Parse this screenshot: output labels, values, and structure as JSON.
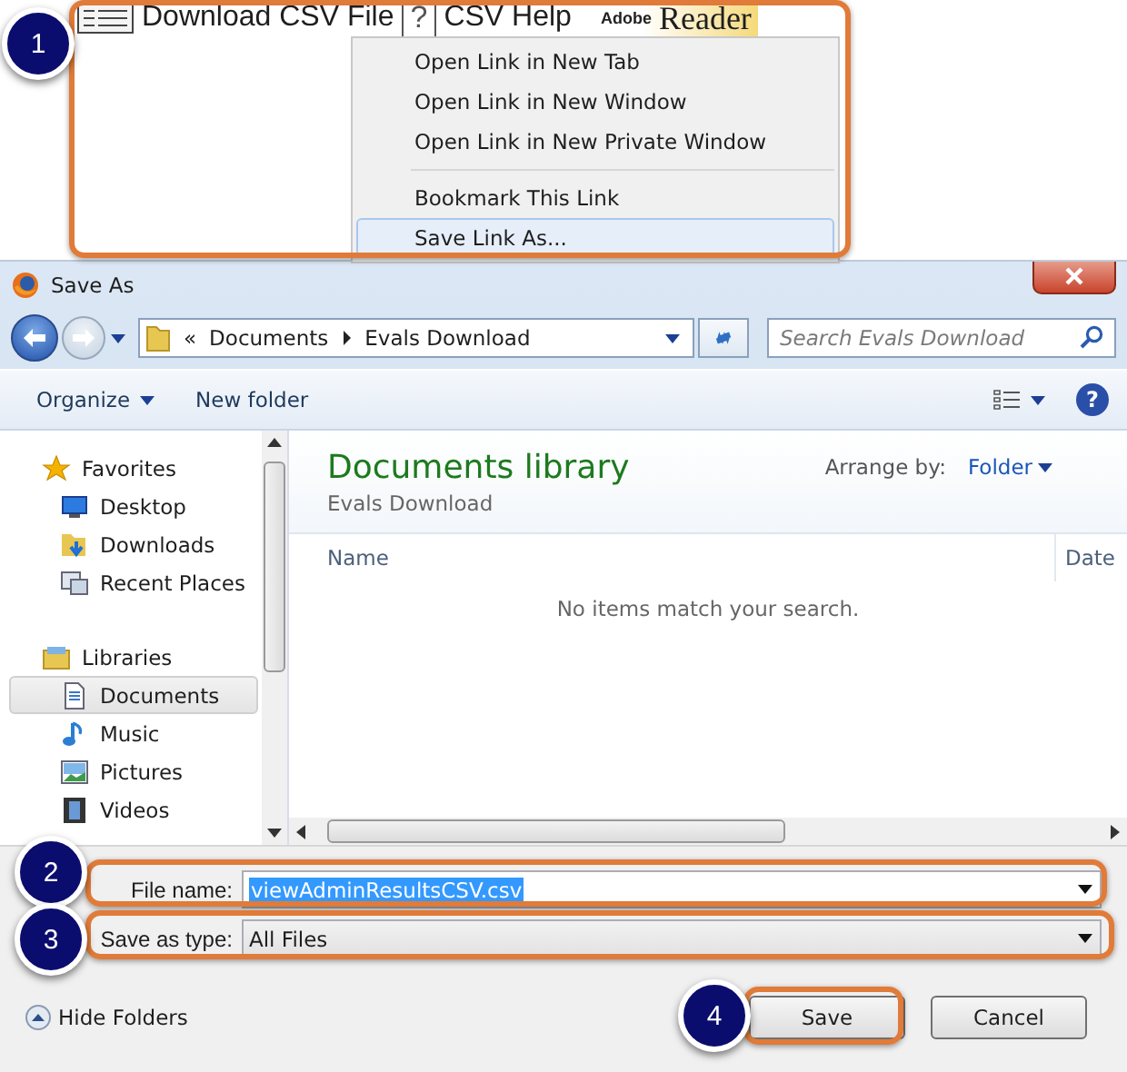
{
  "page_row": {
    "link": "Download CSV File",
    "help_mark": "?",
    "help_link": "CSV Help",
    "badge_words": [
      "Adobe",
      "Reader"
    ]
  },
  "context_menu": {
    "groups": [
      [
        {
          "label": "Open Link in New Tab",
          "selected": false
        },
        {
          "label": "Open Link in New Window",
          "selected": false
        },
        {
          "label": "Open Link in New Private Window",
          "selected": false
        }
      ],
      [
        {
          "label": "Bookmark This Link",
          "selected": false
        },
        {
          "label": "Save Link As...",
          "selected": true
        }
      ]
    ]
  },
  "window": {
    "title": "Save As"
  },
  "address_bar": {
    "lead": "«",
    "crumbs": [
      "Documents",
      "Evals Download"
    ]
  },
  "search": {
    "placeholder": "Search Evals Download"
  },
  "toolbar": {
    "buttons": [
      "Organize",
      "New folder"
    ],
    "help_mark": "?"
  },
  "sidebar": {
    "items": [
      {
        "label": "Favorites",
        "selected": false,
        "children": [
          {
            "label": "Desktop",
            "selected": false
          },
          {
            "label": "Downloads",
            "selected": false
          },
          {
            "label": "Recent Places",
            "selected": false
          }
        ]
      },
      {
        "label": "Libraries",
        "selected": false,
        "children": [
          {
            "label": "Documents",
            "selected": true
          },
          {
            "label": "Music",
            "selected": false
          },
          {
            "label": "Pictures",
            "selected": false
          },
          {
            "label": "Videos",
            "selected": false
          }
        ]
      }
    ]
  },
  "library": {
    "title": "Documents library",
    "subtitle": "Evals Download",
    "arrange_label": "Arrange by:",
    "arrange_value": "Folder"
  },
  "table": {
    "columns": [
      "Name",
      "Date"
    ],
    "empty_message": "No items match your search."
  },
  "form": {
    "file_name_label": "File name:",
    "file_name": "viewAdminResultsCSV.csv",
    "type_label": "Save as type:",
    "type_value": "All Files"
  },
  "footer": {
    "hide_folders": "Hide Folders",
    "buttons": [
      "Save",
      "Cancel"
    ]
  },
  "callouts": [
    "1",
    "2",
    "3",
    "4"
  ]
}
